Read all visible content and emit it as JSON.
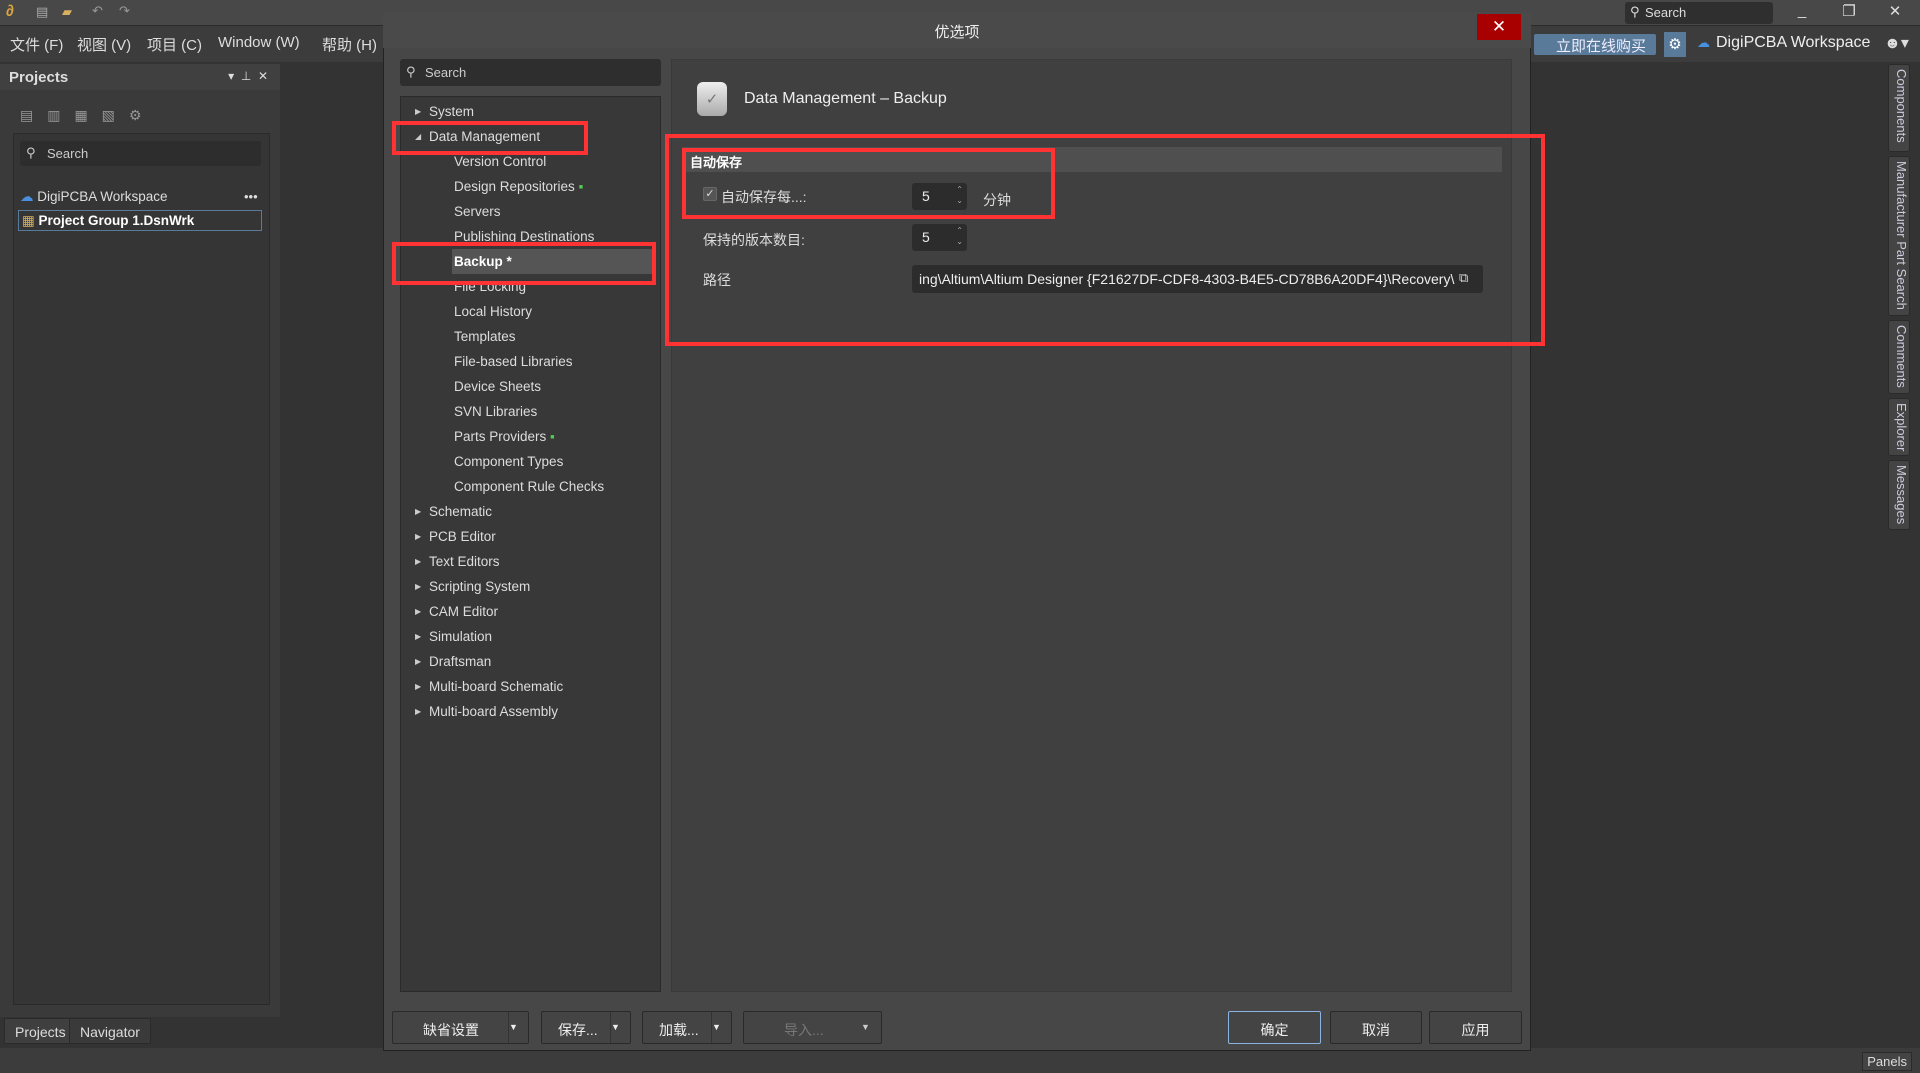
{
  "app": {
    "menu": [
      "文件 (F)",
      "视图 (V)",
      "项目 (C)",
      "Window (W)",
      "帮助 (H)"
    ],
    "search_placeholder": "Search",
    "buy_label": "立即在线购买",
    "workspace": "DigiPCBA Workspace"
  },
  "projects": {
    "title": "Projects",
    "search_placeholder": "Search",
    "workspace": "DigiPCBA Workspace",
    "project": "Project Group 1.DsnWrk",
    "tabs": [
      "Projects",
      "Navigator"
    ]
  },
  "side_panels": [
    "Components",
    "Manufacturer Part Search",
    "Comments",
    "Explorer",
    "Messages"
  ],
  "status": {
    "panels": "Panels"
  },
  "dialog": {
    "title": "优选项",
    "search_placeholder": "Search",
    "tree": [
      {
        "label": "System",
        "level": 0,
        "expanded": false
      },
      {
        "label": "Data Management",
        "level": 0,
        "expanded": true
      },
      {
        "label": "Version Control",
        "level": 1
      },
      {
        "label": "Design Repositories",
        "level": 1,
        "badge": true
      },
      {
        "label": "Servers",
        "level": 1
      },
      {
        "label": "Publishing Destinations",
        "level": 1
      },
      {
        "label": "Backup *",
        "level": 1,
        "selected": true
      },
      {
        "label": "File Locking",
        "level": 1
      },
      {
        "label": "Local History",
        "level": 1
      },
      {
        "label": "Templates",
        "level": 1
      },
      {
        "label": "File-based Libraries",
        "level": 1
      },
      {
        "label": "Device Sheets",
        "level": 1
      },
      {
        "label": "SVN Libraries",
        "level": 1
      },
      {
        "label": "Parts Providers",
        "level": 1,
        "badge": true
      },
      {
        "label": "Component Types",
        "level": 1
      },
      {
        "label": "Component Rule Checks",
        "level": 1
      },
      {
        "label": "Schematic",
        "level": 0
      },
      {
        "label": "PCB Editor",
        "level": 0
      },
      {
        "label": "Text Editors",
        "level": 0
      },
      {
        "label": "Scripting System",
        "level": 0
      },
      {
        "label": "CAM Editor",
        "level": 0
      },
      {
        "label": "Simulation",
        "level": 0
      },
      {
        "label": "Draftsman",
        "level": 0
      },
      {
        "label": "Multi-board Schematic",
        "level": 0
      },
      {
        "label": "Multi-board Assembly",
        "level": 0
      }
    ],
    "page_title": "Data Management – Backup",
    "section": "自动保存",
    "autosave_label": "自动保存每...:",
    "autosave_checked": true,
    "autosave_value": "5",
    "autosave_unit": "分钟",
    "versions_label": "保持的版本数目:",
    "versions_value": "5",
    "path_label": "路径",
    "path_value": "ing\\Altium\\Altium Designer {F21627DF-CDF8-4303-B4E5-CD78B6A20DF4}\\Recovery\\",
    "buttons": {
      "defaults": "缺省设置",
      "save": "保存...",
      "load": "加载...",
      "import": "导入...",
      "ok": "确定",
      "cancel": "取消",
      "apply": "应用"
    }
  },
  "colors": {
    "highlight": "#ff3333",
    "close": "#a80000",
    "accent": "#5a7a9a"
  }
}
